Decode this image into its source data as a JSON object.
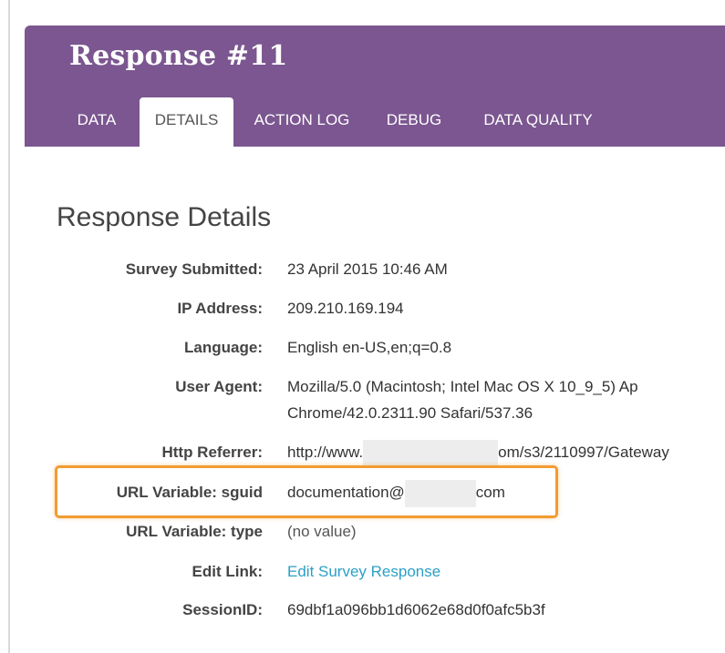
{
  "header": {
    "title": "Response #11",
    "tabs": [
      {
        "label": "DATA"
      },
      {
        "label": "DETAILS"
      },
      {
        "label": "ACTION LOG"
      },
      {
        "label": "DEBUG"
      },
      {
        "label": "DATA QUALITY"
      }
    ],
    "active_tab": "DETAILS",
    "header_color": "#7b5690"
  },
  "details": {
    "section_title": "Response Details",
    "survey_submitted": {
      "label": "Survey Submitted:",
      "value": "23 April 2015 10:46 AM"
    },
    "ip_address": {
      "label": "IP Address:",
      "value": "209.210.169.194"
    },
    "language": {
      "label": "Language:",
      "value": "English en-US,en;q=0.8"
    },
    "user_agent": {
      "label": "User Agent:",
      "value_line1": "Mozilla/5.0 (Macintosh; Intel Mac OS X 10_9_5) Ap",
      "value_line2": "Chrome/42.0.2311.90 Safari/537.36"
    },
    "http_referrer": {
      "label": "Http Referrer:",
      "value_prefix": "http://www.",
      "value_suffix": "om/s3/2110997/Gateway"
    },
    "url_variable_sguid": {
      "label": "URL Variable: sguid",
      "value_prefix": "documentation@",
      "value_suffix": "com"
    },
    "url_variable_type": {
      "label": "URL Variable: type",
      "value": "(no value)"
    },
    "edit_link": {
      "label": "Edit Link:",
      "value": "Edit Survey Response"
    },
    "session_id": {
      "label": "SessionID:",
      "value": "69dbf1a096bb1d6062e68d0f0afc5b3f"
    }
  },
  "colors": {
    "highlight": "#f29b32",
    "link": "#2ba0c7"
  }
}
